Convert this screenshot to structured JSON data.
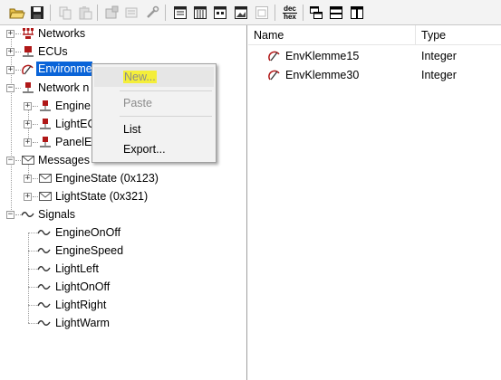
{
  "toolbar": {
    "buttons": [
      {
        "name": "open-folder-icon",
        "enabled": true
      },
      {
        "name": "save-icon",
        "enabled": true
      },
      {
        "name": "copy-icon",
        "enabled": false
      },
      {
        "name": "paste-icon",
        "enabled": false
      },
      {
        "name": "new-node-icon",
        "enabled": false
      },
      {
        "name": "properties-icon",
        "enabled": false
      },
      {
        "name": "tools-icon",
        "enabled": false
      },
      {
        "name": "view-tree-icon",
        "enabled": true
      },
      {
        "name": "view-columns-icon",
        "enabled": true
      },
      {
        "name": "view-grid-icon",
        "enabled": true
      },
      {
        "name": "view-image-icon",
        "enabled": true
      },
      {
        "name": "view-overview-icon",
        "enabled": false
      },
      {
        "name": "dec-hex-icon",
        "enabled": true
      },
      {
        "name": "layout-cascade-icon",
        "enabled": true
      },
      {
        "name": "layout-horizontal-icon",
        "enabled": true
      },
      {
        "name": "layout-vertical-icon",
        "enabled": true
      }
    ],
    "dec_text": "dec",
    "hex_text": "hex"
  },
  "tree": {
    "networks": "Networks",
    "ecus": "ECUs",
    "environment": "Environme",
    "network_nodes": "Network n",
    "node_engine": "Engine",
    "node_light": "LightEC",
    "node_panel": "PanelEC",
    "messages": "Messages",
    "msg_engine_state": "EngineState (0x123)",
    "msg_light_state": "LightState (0x321)",
    "signals": "Signals",
    "signal_items": [
      "EngineOnOff",
      "EngineSpeed",
      "LightLeft",
      "LightOnOff",
      "LightRight",
      "LightWarm"
    ]
  },
  "list": {
    "col_name": "Name",
    "col_type": "Type",
    "rows": [
      {
        "name": "EnvKlemme15",
        "type": "Integer"
      },
      {
        "name": "EnvKlemme30",
        "type": "Integer"
      }
    ]
  },
  "context_menu": {
    "new": "New...",
    "paste": "Paste",
    "list": "List",
    "export": "Export..."
  },
  "colors": {
    "selection": "#0a64d8",
    "highlight": "#f4ee3a",
    "ecu_red": "#b01818"
  }
}
